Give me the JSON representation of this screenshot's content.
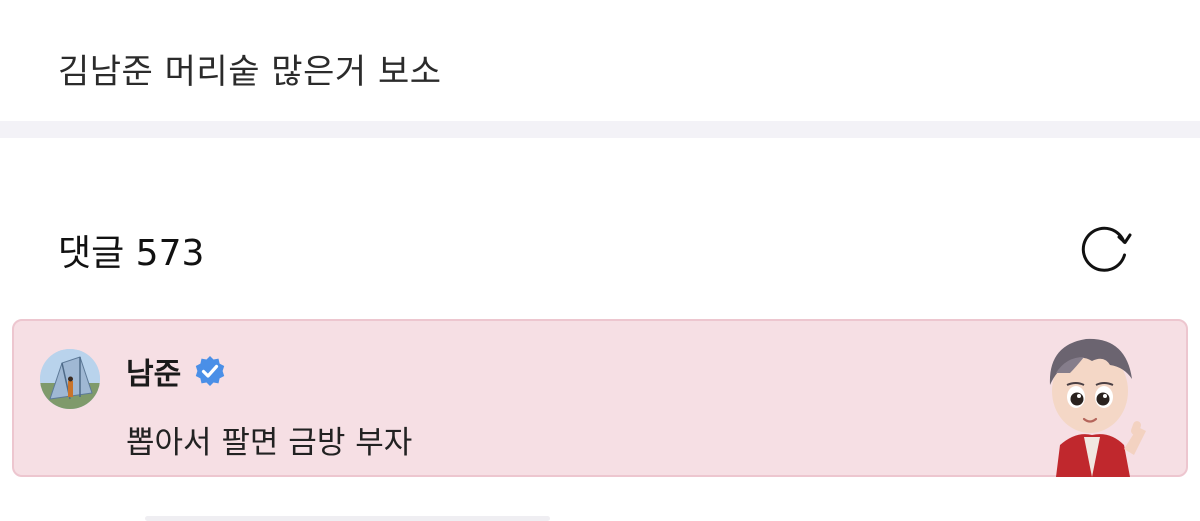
{
  "post": {
    "title": "김남준 머리숱 많은거 보소"
  },
  "comments": {
    "header": "댓글 573",
    "refresh_icon": "refresh-icon"
  },
  "comment": {
    "author": "남준",
    "verified_icon": "verified-badge-icon",
    "text": "뽑아서 팔면 금방 부자",
    "background_color": "#f6dfe4",
    "badge_color": "#4a8fe7"
  }
}
